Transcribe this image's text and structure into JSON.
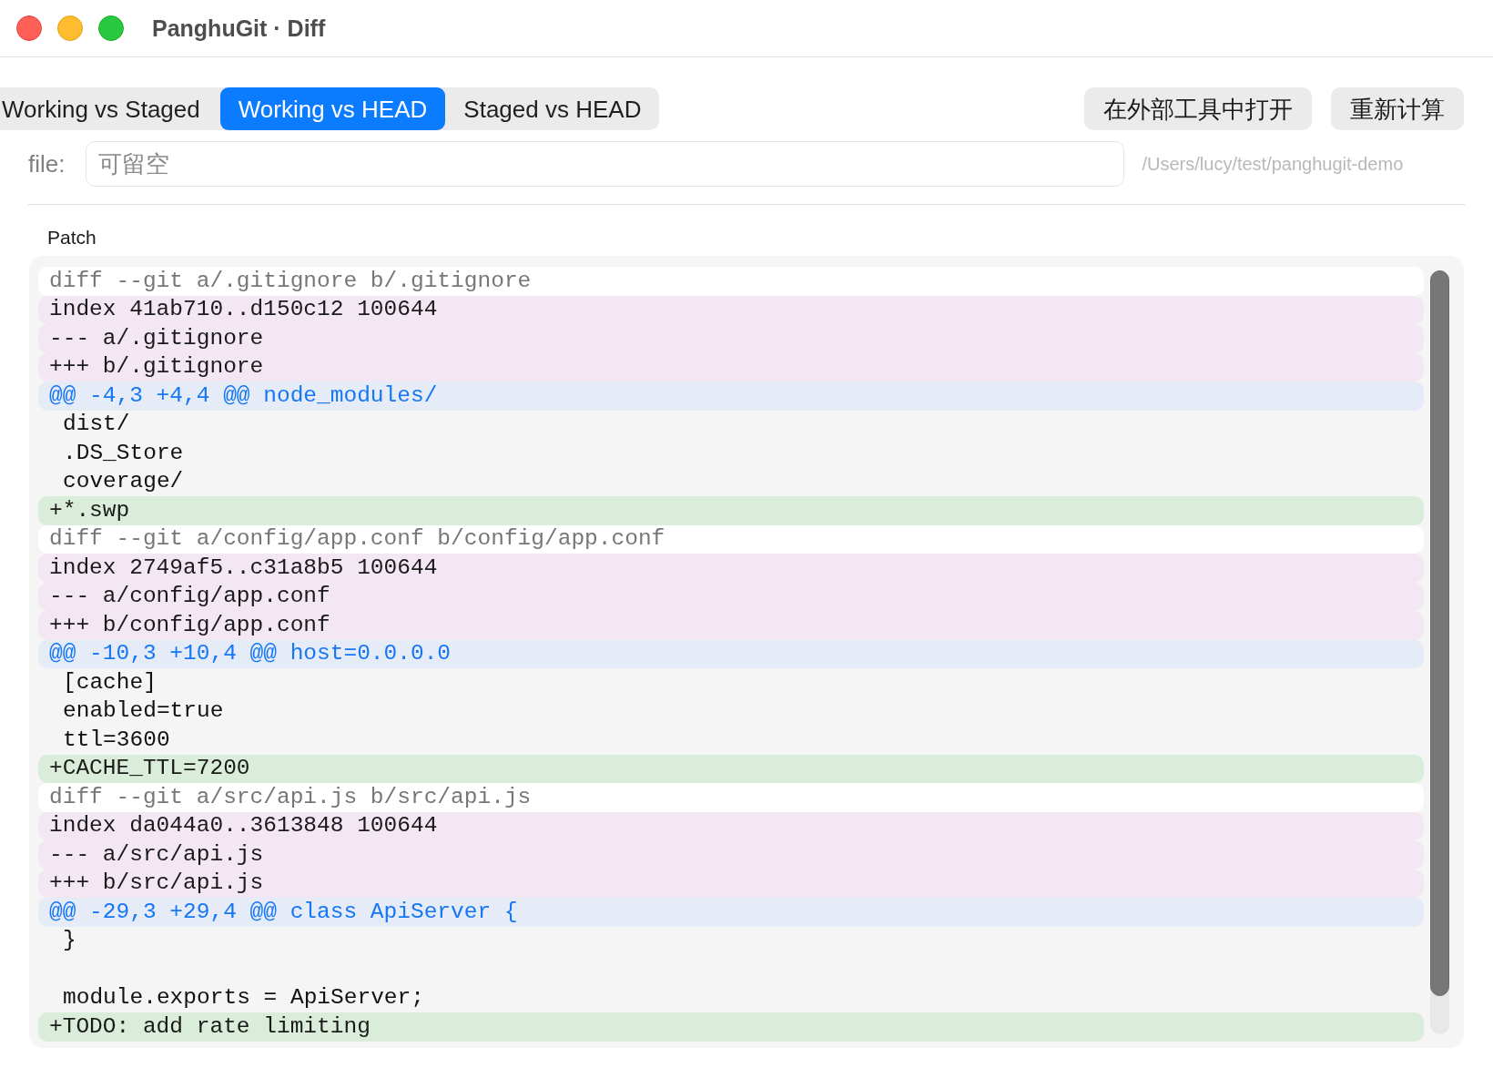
{
  "window": {
    "title": "PanghuGit · Diff"
  },
  "tabs": [
    {
      "label": "Working vs Staged",
      "selected": false
    },
    {
      "label": "Working vs HEAD",
      "selected": true
    },
    {
      "label": "Staged vs HEAD",
      "selected": false
    }
  ],
  "buttons": [
    "在外部工具中打开",
    "重新计算"
  ],
  "file_field": {
    "label": "file:",
    "placeholder": "可留空"
  },
  "repo_path": "/Users/lucy/test/panghugit-demo",
  "patch": {
    "label": "Patch",
    "lines": [
      {
        "kind": "file_header",
        "text": "diff --git a/.gitignore b/.gitignore"
      },
      {
        "kind": "meta",
        "text": "index 41ab710..d150c12 100644"
      },
      {
        "kind": "meta",
        "text": "--- a/.gitignore"
      },
      {
        "kind": "meta",
        "text": "+++ b/.gitignore"
      },
      {
        "kind": "hunk",
        "text": "@@ -4,3 +4,4 @@ node_modules/"
      },
      {
        "kind": "context",
        "text": "dist/"
      },
      {
        "kind": "context",
        "text": ".DS_Store"
      },
      {
        "kind": "context",
        "text": "coverage/"
      },
      {
        "kind": "added",
        "text": "+*.swp"
      },
      {
        "kind": "file_header",
        "text": "diff --git a/config/app.conf b/config/app.conf"
      },
      {
        "kind": "meta",
        "text": "index 2749af5..c31a8b5 100644"
      },
      {
        "kind": "meta",
        "text": "--- a/config/app.conf"
      },
      {
        "kind": "meta",
        "text": "+++ b/config/app.conf"
      },
      {
        "kind": "hunk",
        "text": "@@ -10,3 +10,4 @@ host=0.0.0.0"
      },
      {
        "kind": "context",
        "text": "[cache]"
      },
      {
        "kind": "context",
        "text": "enabled=true"
      },
      {
        "kind": "context",
        "text": "ttl=3600"
      },
      {
        "kind": "added",
        "text": "+CACHE_TTL=7200"
      },
      {
        "kind": "file_header",
        "text": "diff --git a/src/api.js b/src/api.js"
      },
      {
        "kind": "meta",
        "text": "index da044a0..3613848 100644"
      },
      {
        "kind": "meta",
        "text": "--- a/src/api.js"
      },
      {
        "kind": "meta",
        "text": "+++ b/src/api.js"
      },
      {
        "kind": "hunk",
        "text": "@@ -29,3 +29,4 @@ class ApiServer {"
      },
      {
        "kind": "context",
        "text": "}"
      },
      {
        "kind": "blank"
      },
      {
        "kind": "context",
        "text": "module.exports = ApiServer;"
      },
      {
        "kind": "added",
        "text": "+TODO: add rate limiting"
      }
    ]
  }
}
